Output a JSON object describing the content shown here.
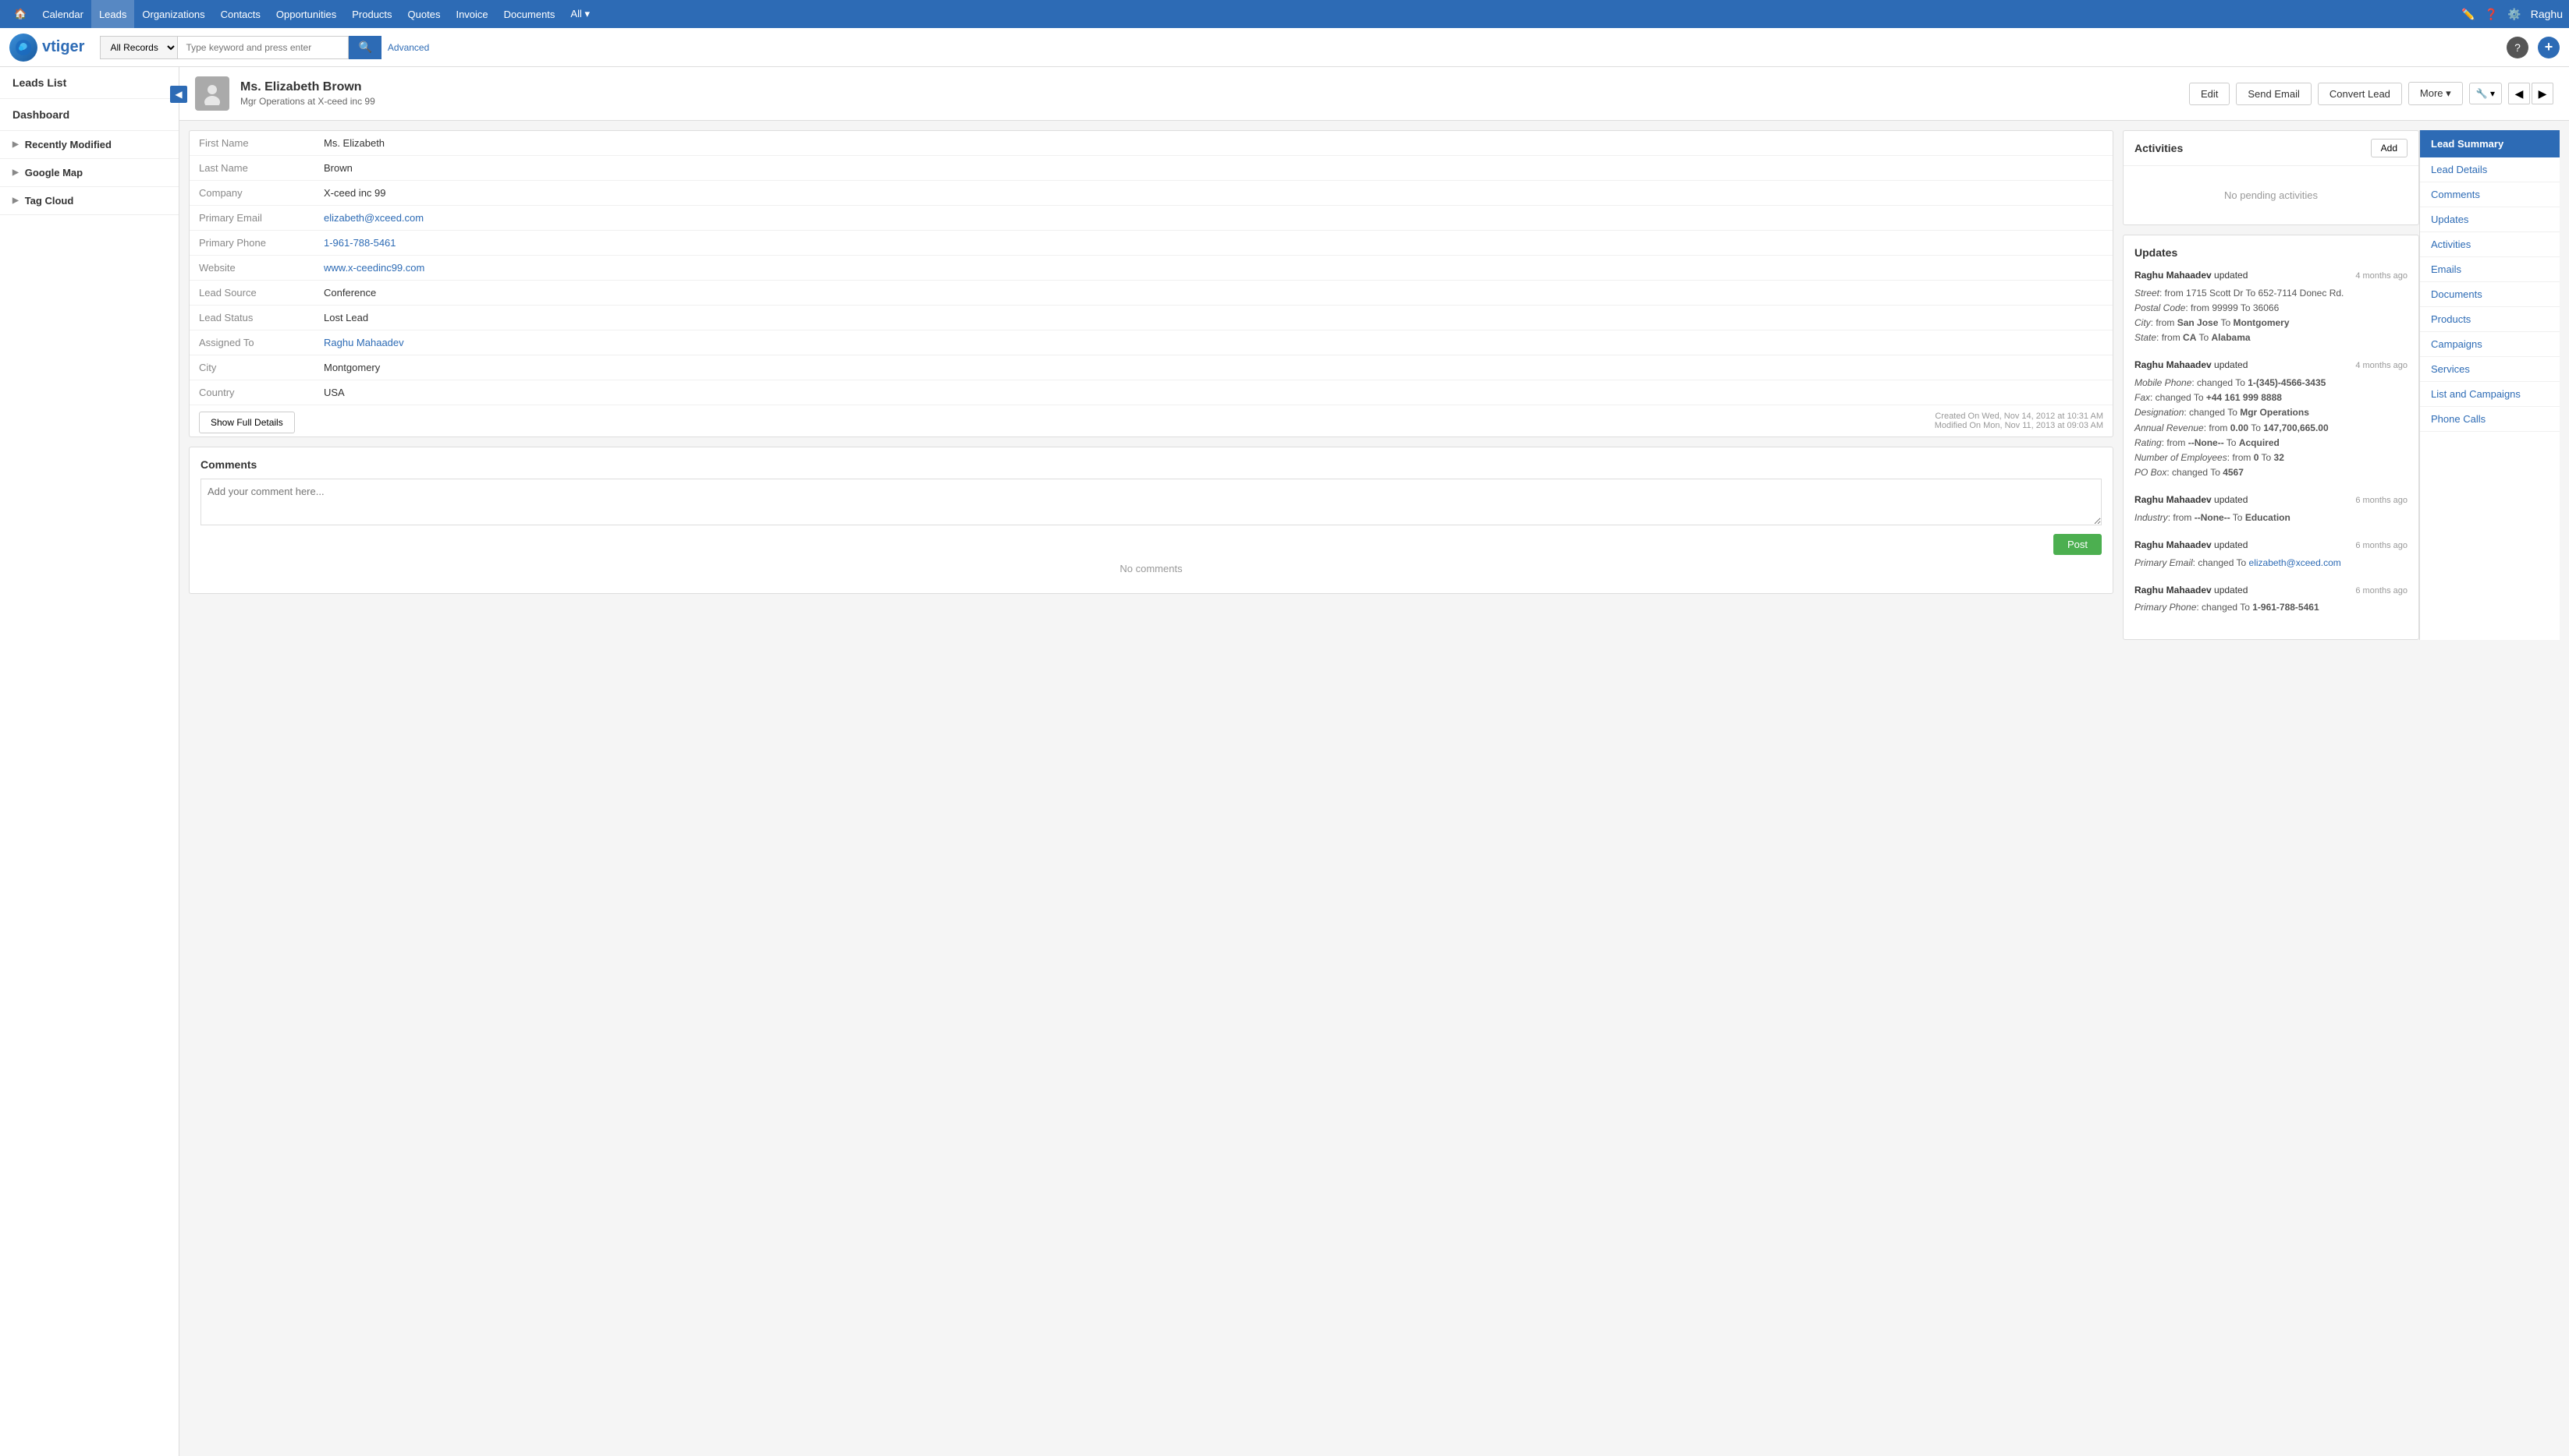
{
  "topNav": {
    "items": [
      {
        "label": "Home",
        "icon": "🏠",
        "active": false
      },
      {
        "label": "Calendar",
        "active": false
      },
      {
        "label": "Leads",
        "active": true
      },
      {
        "label": "Organizations",
        "active": false
      },
      {
        "label": "Contacts",
        "active": false
      },
      {
        "label": "Opportunities",
        "active": false
      },
      {
        "label": "Products",
        "active": false
      },
      {
        "label": "Quotes",
        "active": false
      },
      {
        "label": "Invoice",
        "active": false
      },
      {
        "label": "Documents",
        "active": false
      },
      {
        "label": "All",
        "active": false,
        "hasDropdown": true
      }
    ],
    "rightIcons": [
      "✏️",
      "❓",
      "⚙️"
    ],
    "username": "Raghu"
  },
  "searchBar": {
    "logoText": "vtiger",
    "selectOptions": [
      "All Records"
    ],
    "selectValue": "All Records",
    "placeholder": "Type keyword and press enter",
    "advancedLabel": "Advanced"
  },
  "sidebar": {
    "leadsListLabel": "Leads List",
    "dashboardLabel": "Dashboard",
    "sections": [
      {
        "label": "Recently Modified",
        "expanded": false
      },
      {
        "label": "Google Map",
        "expanded": false
      },
      {
        "label": "Tag Cloud",
        "expanded": false
      }
    ]
  },
  "leadHeader": {
    "name": "Ms. Elizabeth Brown",
    "subtitle": "Mgr Operations at X-ceed inc 99",
    "buttons": {
      "edit": "Edit",
      "sendEmail": "Send Email",
      "convertLead": "Convert Lead",
      "more": "More",
      "toolIcon": "🔧"
    }
  },
  "leadDetails": {
    "fields": [
      {
        "label": "First Name",
        "value": "Ms. Elizabeth",
        "isLink": false
      },
      {
        "label": "Last Name",
        "value": "Brown",
        "isLink": false
      },
      {
        "label": "Company",
        "value": "X-ceed inc 99",
        "isLink": false
      },
      {
        "label": "Primary Email",
        "value": "elizabeth@xceed.com",
        "isLink": true
      },
      {
        "label": "Primary Phone",
        "value": "1-961-788-5461",
        "isLink": true
      },
      {
        "label": "Website",
        "value": "www.x-ceedinc99.com",
        "isLink": true
      },
      {
        "label": "Lead Source",
        "value": "Conference",
        "isLink": false
      },
      {
        "label": "Lead Status",
        "value": "Lost Lead",
        "isLink": false
      },
      {
        "label": "Assigned To",
        "value": "Raghu Mahaadev",
        "isLink": true
      },
      {
        "label": "City",
        "value": "Montgomery",
        "isLink": false
      },
      {
        "label": "Country",
        "value": "USA",
        "isLink": false
      }
    ],
    "showFullDetailsLabel": "Show Full Details",
    "createdOn": "Created On Wed, Nov 14, 2012 at 10:31 AM",
    "modifiedOn": "Modified On Mon, Nov 11, 2013 at 09:03 AM"
  },
  "comments": {
    "title": "Comments",
    "placeholder": "Add your comment here...",
    "postLabel": "Post",
    "noCommentsLabel": "No comments"
  },
  "activities": {
    "title": "Activities",
    "addLabel": "Add",
    "noPendingLabel": "No pending activities"
  },
  "updates": {
    "title": "Updates",
    "entries": [
      {
        "user": "Raghu Mahaadev",
        "action": "updated",
        "time": "4 months ago",
        "lines": [
          "Street: from 1715 Scott Dr To 652-7114 Donec Rd.",
          "Postal Code: from 99999 To 36066",
          "City: from San Jose To Montgomery",
          "State: from CA To Alabama"
        ]
      },
      {
        "user": "Raghu Mahaadev",
        "action": "updated",
        "time": "4 months ago",
        "lines": [
          "Mobile Phone: changed To 1-(345)-4566-3435",
          "Fax: changed To +44 161 999 8888",
          "Designation: changed To Mgr Operations",
          "Annual Revenue: from 0.00 To 147,700,665.00",
          "Rating: from --None-- To Acquired",
          "Number of Employees: from 0 To 32",
          "PO Box: changed To 4567"
        ]
      },
      {
        "user": "Raghu Mahaadev",
        "action": "updated",
        "time": "6 months ago",
        "lines": [
          "Industry: from --None-- To Education"
        ]
      },
      {
        "user": "Raghu Mahaadev",
        "action": "updated",
        "time": "6 months ago",
        "lines": [
          "Primary Email: changed To elizabeth@xceed.com"
        ],
        "hasLink": true
      },
      {
        "user": "Raghu Mahaadev",
        "action": "updated",
        "time": "6 months ago",
        "lines": [
          "Primary Phone: changed To 1-961-788-5461"
        ]
      }
    ]
  },
  "rightNav": {
    "header": "Lead Summary",
    "items": [
      "Lead Details",
      "Comments",
      "Updates",
      "Activities",
      "Emails",
      "Documents",
      "Products",
      "Campaigns",
      "Services",
      "List and Campaigns",
      "Phone Calls"
    ]
  }
}
